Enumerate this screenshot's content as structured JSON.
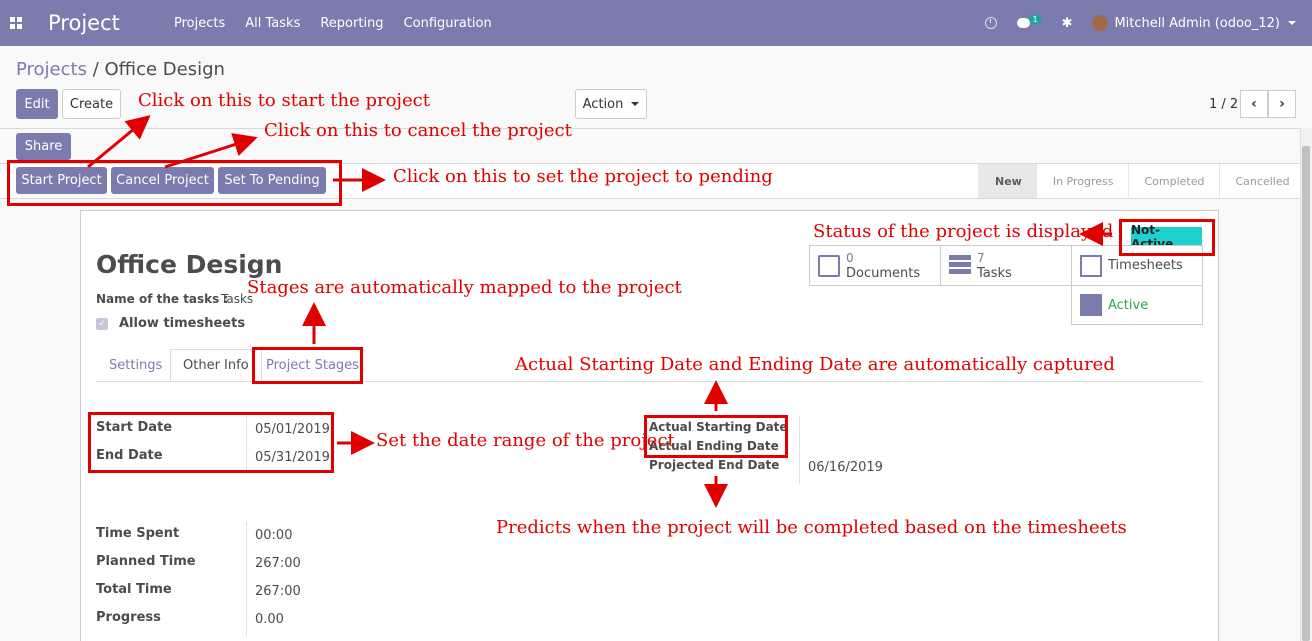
{
  "navbar": {
    "brand": "Project",
    "menu": [
      "Projects",
      "All Tasks",
      "Reporting",
      "Configuration"
    ],
    "chat_badge": "1",
    "user": "Mitchell Admin (odoo_12)",
    "color": "#7c7bad"
  },
  "breadcrumb": {
    "parent": "Projects",
    "separator": "/",
    "current": "Office Design"
  },
  "control_panel": {
    "edit_label": "Edit",
    "create_label": "Create",
    "action_label": "Action",
    "pager": "1 / 2",
    "share_label": "Share"
  },
  "header_buttons": {
    "start": "Start Project",
    "cancel": "Cancel Project",
    "pending": "Set To Pending"
  },
  "stages": [
    "New",
    "In Progress",
    "Completed",
    "Cancelled"
  ],
  "active_stage": "New",
  "sheet": {
    "title": "Office Design",
    "tasks_name_label": "Name of the tasks :",
    "tasks_name_value": "Tasks",
    "allow_timesheets": "Allow timesheets",
    "status_tag": "Not-Active",
    "stats": {
      "documents_count": "0",
      "documents_label": "Documents",
      "tasks_count": "7",
      "tasks_label": "Tasks",
      "timesheets_label": "Timesheets",
      "active_label": "Active"
    },
    "tabs": [
      "Settings",
      "Other Info",
      "Project Stages"
    ],
    "active_tab": "Other Info",
    "dates": {
      "start_label": "Start Date",
      "start_value": "05/01/2019",
      "end_label": "End Date",
      "end_value": "05/31/2019",
      "actual_start_label": "Actual Starting Date",
      "actual_end_label": "Actual Ending Date",
      "projected_end_label": "Projected End Date",
      "projected_end_value": "06/16/2019"
    },
    "times": [
      {
        "label": "Time Spent",
        "value": "00:00"
      },
      {
        "label": "Planned Time",
        "value": "267:00"
      },
      {
        "label": "Total Time",
        "value": "267:00"
      },
      {
        "label": "Progress",
        "value": "0.00"
      }
    ]
  },
  "annotations": {
    "start": "Click on this to start the project",
    "cancel": "Click on this to cancel the project",
    "pending": "Click on this to set the project to pending",
    "status": "Status of the project is displayed",
    "stages": "Stages are automatically mapped to the project",
    "actual_dates": "Actual Starting Date and Ending Date are automatically captured",
    "date_range": "Set the date range of the project",
    "predict": "Predicts when the project will be completed based on the timesheets",
    "color": "#e00000"
  }
}
